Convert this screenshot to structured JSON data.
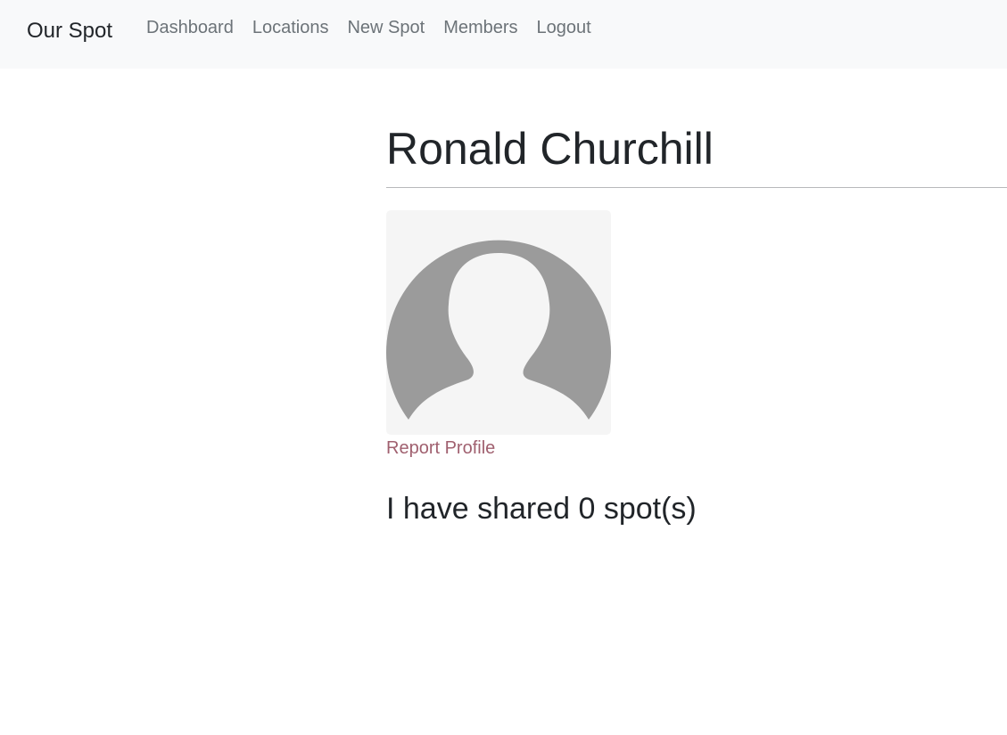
{
  "navbar": {
    "brand": "Our Spot",
    "links": [
      {
        "label": "Dashboard"
      },
      {
        "label": "Locations"
      },
      {
        "label": "New Spot"
      },
      {
        "label": "Members"
      },
      {
        "label": "Logout"
      }
    ]
  },
  "profile": {
    "name": "Ronald Churchill",
    "avatar_icon": "default-user-silhouette-icon",
    "report_label": "Report Profile",
    "shared_text": "I have shared 0 spot(s)"
  },
  "colors": {
    "navbar_background": "#f8f9fa",
    "link_muted": "#6c7378",
    "report_link": "#a0606f",
    "avatar_silhouette": "#9b9b9b",
    "avatar_background": "#f5f5f5"
  }
}
